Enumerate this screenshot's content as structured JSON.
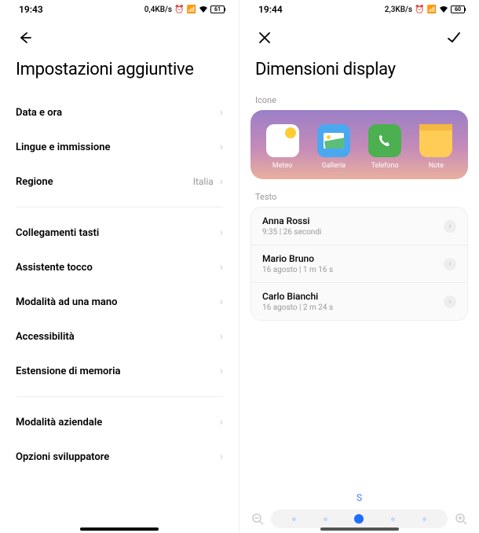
{
  "left": {
    "status": {
      "time": "19:43",
      "speed": "0,4KB/s"
    },
    "title": "Impostazioni aggiuntive",
    "rows1": [
      {
        "label": "Data e ora",
        "value": ""
      },
      {
        "label": "Lingue e immissione",
        "value": ""
      },
      {
        "label": "Regione",
        "value": "Italia"
      }
    ],
    "rows2": [
      {
        "label": "Collegamenti tasti"
      },
      {
        "label": "Assistente tocco"
      },
      {
        "label": "Modalità ad una mano"
      },
      {
        "label": "Accessibilità"
      },
      {
        "label": "Estensione di memoria"
      }
    ],
    "rows3": [
      {
        "label": "Modalità aziendale"
      },
      {
        "label": "Opzioni sviluppatore"
      }
    ]
  },
  "right": {
    "status": {
      "time": "19:44",
      "speed": "2,3KB/s"
    },
    "title": "Dimensioni display",
    "section_icons": "Icone",
    "apps": [
      {
        "name": "Meteo"
      },
      {
        "name": "Galleria"
      },
      {
        "name": "Telefono"
      },
      {
        "name": "Note"
      }
    ],
    "section_text": "Testo",
    "calls": [
      {
        "name": "Anna Rossi",
        "meta": "9:35 | 26 secondi"
      },
      {
        "name": "Mario Bruno",
        "meta": "16 agosto | 1 m 16 s"
      },
      {
        "name": "Carlo Bianchi",
        "meta": "16 agosto | 2 m 24 s"
      }
    ],
    "size_letter": "S",
    "battery_pct": "60"
  }
}
